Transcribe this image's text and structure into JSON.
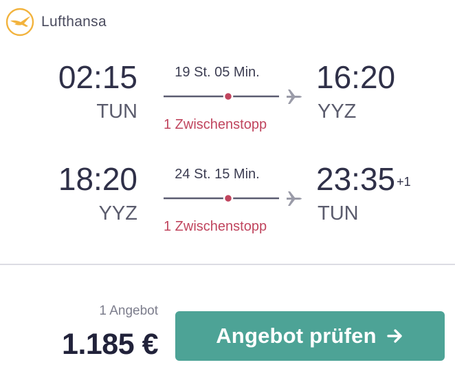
{
  "airline": {
    "name": "Lufthansa",
    "logo_icon": "lufthansa-crane-logo",
    "logo_color": "#F2B33D"
  },
  "legs": [
    {
      "departure_time": "02:15",
      "departure_code": "TUN",
      "arrival_time": "16:20",
      "arrival_day_offset": "",
      "arrival_code": "YYZ",
      "duration": "19 St. 05 Min.",
      "stops": "1 Zwischenstopp"
    },
    {
      "departure_time": "18:20",
      "departure_code": "YYZ",
      "arrival_time": "23:35",
      "arrival_day_offset": "+1",
      "arrival_code": "TUN",
      "duration": "24 St. 15 Min.",
      "stops": "1 Zwischenstopp"
    }
  ],
  "footer": {
    "offers_count": "1 Angebot",
    "price": "1.185 €",
    "cta_label": "Angebot prüfen",
    "cta_icon": "arrow-right-icon"
  },
  "colors": {
    "accent": "#4DA396",
    "stop_text": "#C0455E",
    "stop_dot": "#C0455E",
    "text_dark": "#2F3048",
    "route_line": "#5A5B70"
  }
}
